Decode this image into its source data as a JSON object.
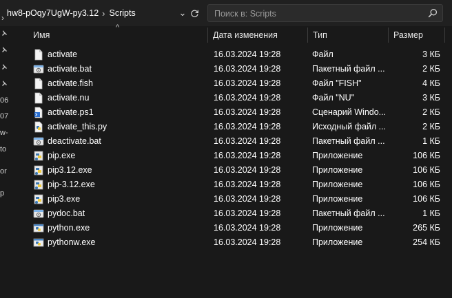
{
  "address": {
    "crumbs": [
      "hw8-pOqy7UgW-py3.12",
      "Scripts"
    ],
    "search_placeholder": "Поиск в: Scripts"
  },
  "nav_fragments": [
    "06",
    "07",
    "w-",
    "to",
    "or",
    "p"
  ],
  "columns": {
    "name": "Имя",
    "date": "Дата изменения",
    "type": "Тип",
    "size": "Размер"
  },
  "files": [
    {
      "name": "activate",
      "date": "16.03.2024 19:28",
      "type": "Файл",
      "size": "3 КБ",
      "icon": "blank-file-icon"
    },
    {
      "name": "activate.bat",
      "date": "16.03.2024 19:28",
      "type": "Пакетный файл ...",
      "size": "2 КБ",
      "icon": "batch-file-icon"
    },
    {
      "name": "activate.fish",
      "date": "16.03.2024 19:28",
      "type": "Файл \"FISH\"",
      "size": "4 КБ",
      "icon": "blank-file-icon"
    },
    {
      "name": "activate.nu",
      "date": "16.03.2024 19:28",
      "type": "Файл \"NU\"",
      "size": "3 КБ",
      "icon": "blank-file-icon"
    },
    {
      "name": "activate.ps1",
      "date": "16.03.2024 19:28",
      "type": "Сценарий Windo...",
      "size": "2 КБ",
      "icon": "powershell-file-icon"
    },
    {
      "name": "activate_this.py",
      "date": "16.03.2024 19:28",
      "type": "Исходный файл ...",
      "size": "2 КБ",
      "icon": "python-source-icon"
    },
    {
      "name": "deactivate.bat",
      "date": "16.03.2024 19:28",
      "type": "Пакетный файл ...",
      "size": "1 КБ",
      "icon": "batch-file-icon"
    },
    {
      "name": "pip.exe",
      "date": "16.03.2024 19:28",
      "type": "Приложение",
      "size": "106 КБ",
      "icon": "python-exe-icon"
    },
    {
      "name": "pip3.12.exe",
      "date": "16.03.2024 19:28",
      "type": "Приложение",
      "size": "106 КБ",
      "icon": "python-exe-icon"
    },
    {
      "name": "pip-3.12.exe",
      "date": "16.03.2024 19:28",
      "type": "Приложение",
      "size": "106 КБ",
      "icon": "python-exe-icon"
    },
    {
      "name": "pip3.exe",
      "date": "16.03.2024 19:28",
      "type": "Приложение",
      "size": "106 КБ",
      "icon": "python-exe-icon"
    },
    {
      "name": "pydoc.bat",
      "date": "16.03.2024 19:28",
      "type": "Пакетный файл ...",
      "size": "1 КБ",
      "icon": "batch-file-icon"
    },
    {
      "name": "python.exe",
      "date": "16.03.2024 19:28",
      "type": "Приложение",
      "size": "265 КБ",
      "icon": "python-app-icon"
    },
    {
      "name": "pythonw.exe",
      "date": "16.03.2024 19:28",
      "type": "Приложение",
      "size": "254 КБ",
      "icon": "python-app-icon"
    }
  ]
}
